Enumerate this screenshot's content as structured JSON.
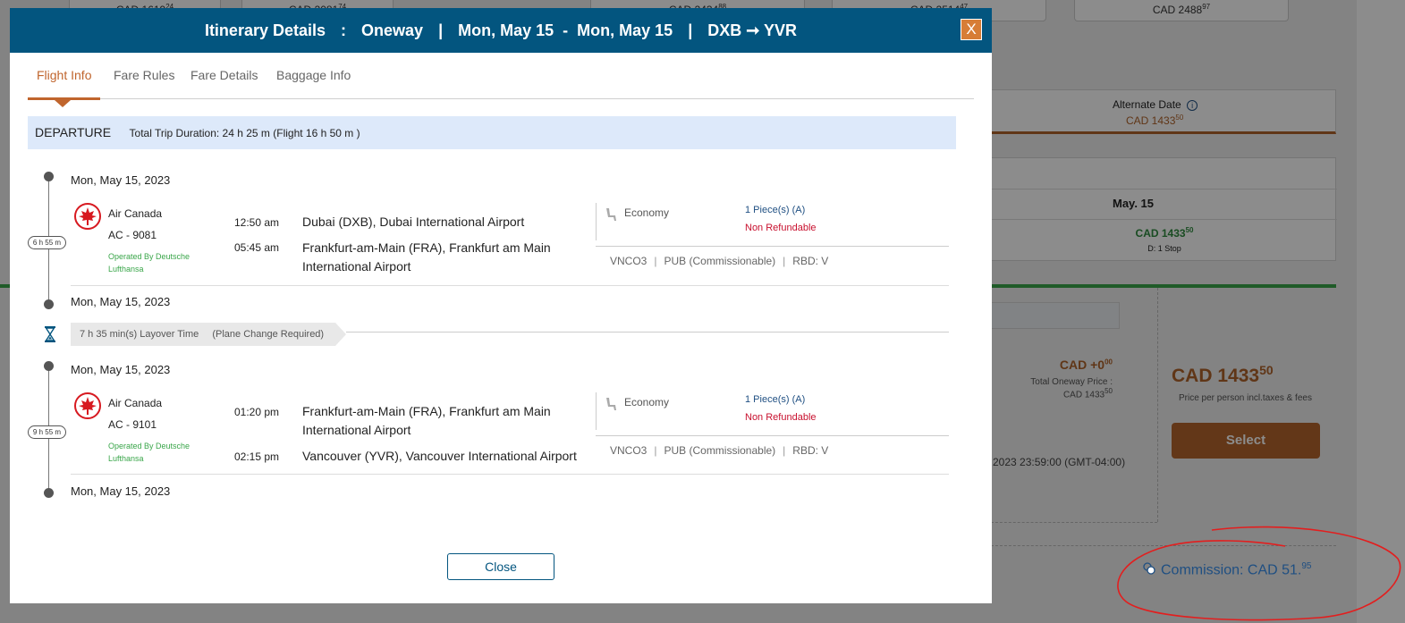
{
  "background": {
    "top_prices": [
      {
        "main": "CAD 1619",
        "cents": "24"
      },
      {
        "main": "CAD 2081",
        "cents": "74"
      },
      {
        "main": "CAD 2434",
        "cents": "88"
      },
      {
        "main": "CAD 2514",
        "cents": "47"
      },
      {
        "main": "CAD 2488",
        "cents": "97"
      }
    ],
    "alternate_date": {
      "label": "Alternate Date",
      "price_main": "CAD 1433",
      "price_cents": "50"
    },
    "date_cell": {
      "label": "May. 15",
      "price_main": "CAD 1433",
      "price_cents": "50",
      "stops": "D: 1 Stop"
    },
    "extra_price": {
      "main": "CAD +0",
      "cents": "00",
      "total_label": "Total Oneway Price :",
      "total_main": "CAD 1433",
      "total_cents": "50"
    },
    "big_price": {
      "main": "CAD 1433",
      "cents": "50",
      "note": "Price per person incl.taxes & fees"
    },
    "select_label": "Select",
    "deadline": "2023 23:59:00 (GMT-04:00)"
  },
  "commission": {
    "label": "Commission: CAD 51.",
    "cents": "95"
  },
  "modal": {
    "title": "Itinerary Details",
    "trip_type": "Oneway",
    "dates": "Mon, May 15  -  Mon, May 15",
    "route": "DXB ➞ YVR",
    "close_x": "X",
    "tabs": [
      "Flight Info",
      "Fare Rules",
      "Fare Details",
      "Baggage Info"
    ],
    "departure_label": "DEPARTURE",
    "trip_duration": "Total Trip Duration: 24 h 25 m (Flight 16 h 50 m )",
    "segments": [
      {
        "date_start": "Mon, May 15, 2023",
        "duration": "6 h 55 m",
        "airline": "Air Canada",
        "flight_no": "AC - 9081",
        "operated_by": "Operated By Deutsche Lufthansa",
        "dep_time": "12:50 am",
        "dep_airport": "Dubai (DXB), Dubai International Airport",
        "arr_time": "05:45 am",
        "arr_airport": "Frankfurt-am-Main (FRA), Frankfurt am Main International Airport",
        "cabin": "Economy",
        "baggage": "1 Piece(s) (A)",
        "refund": "Non Refundable",
        "fare_code": "VNCO3",
        "fare_type": "PUB (Commissionable)",
        "rbd": "RBD: V",
        "date_end": "Mon, May 15, 2023"
      },
      {
        "date_start": "Mon, May 15, 2023",
        "duration": "9 h 55 m",
        "airline": "Air Canada",
        "flight_no": "AC - 9101",
        "operated_by": "Operated By Deutsche Lufthansa",
        "dep_time": "01:20 pm",
        "dep_airport": "Frankfurt-am-Main (FRA), Frankfurt am Main International Airport",
        "arr_time": "02:15 pm",
        "arr_airport": "Vancouver (YVR), Vancouver International Airport",
        "cabin": "Economy",
        "baggage": "1 Piece(s) (A)",
        "refund": "Non Refundable",
        "fare_code": "VNCO3",
        "fare_type": "PUB (Commissionable)",
        "rbd": "RBD: V",
        "date_end": "Mon, May 15, 2023"
      }
    ],
    "layover": {
      "time": "7 h 35 min(s) Layover Time",
      "note": "(Plane Change Required)"
    },
    "close_label": "Close"
  },
  "colors": {
    "header": "#03557f",
    "accent": "#c0652d",
    "refund": "#c8102e",
    "operated": "#3aa64a",
    "annotation": "#e31e1e"
  },
  "icons": [
    "air-canada-logo-icon",
    "seat-icon",
    "hourglass-icon",
    "coins-icon",
    "info-icon"
  ]
}
